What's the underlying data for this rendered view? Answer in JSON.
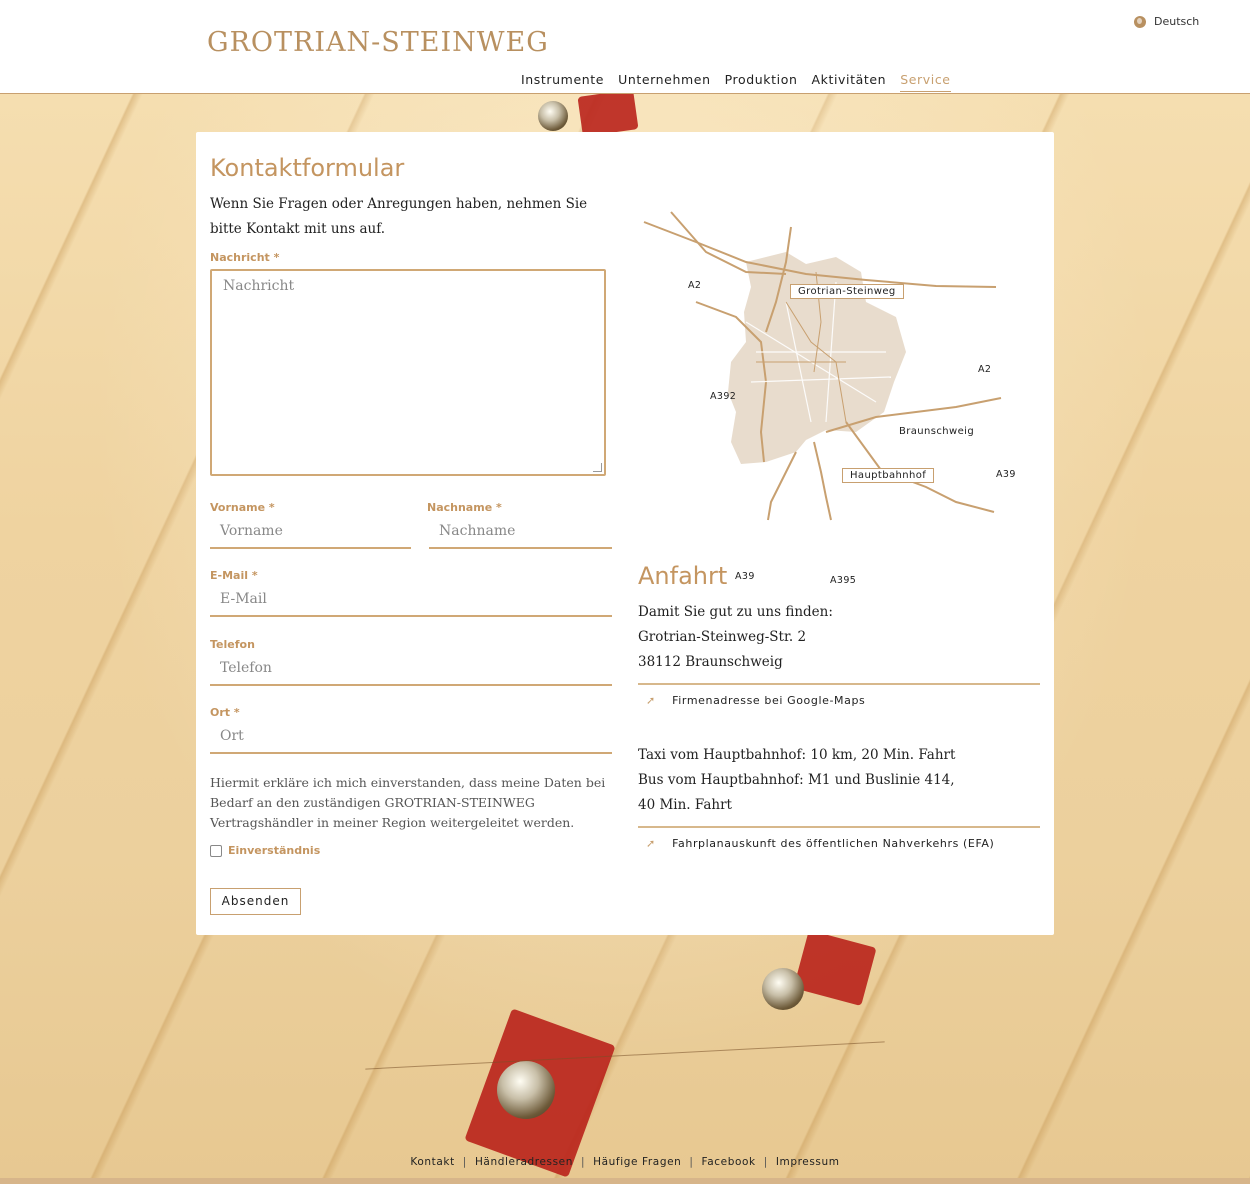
{
  "header": {
    "logo": "GROTRIAN-STEINWEG",
    "language": "Deutsch",
    "nav": [
      "Instrumente",
      "Unternehmen",
      "Produktion",
      "Aktivitäten",
      "Service"
    ],
    "active_nav": "Service"
  },
  "form": {
    "title": "Kontaktformular",
    "intro": "Wenn Sie Fragen oder Anregungen haben, nehmen Sie bitte Kontakt mit uns auf.",
    "message_label": "Nachricht *",
    "message_placeholder": "Nachricht",
    "firstname_label": "Vorname *",
    "firstname_placeholder": "Vorname",
    "lastname_label": "Nachname *",
    "lastname_placeholder": "Nachname",
    "email_label": "E-Mail *",
    "email_placeholder": "E-Mail",
    "phone_label": "Telefon",
    "phone_placeholder": "Telefon",
    "city_label": "Ort *",
    "city_placeholder": "Ort",
    "consent_text": "Hiermit erkläre ich mich einverstanden, dass meine Daten bei Bedarf an den zuständigen GROTRIAN-STEINWEG Vertragshändler in meiner Region weitergeleitet werden.",
    "consent_label": "Einverständnis",
    "submit_label": "Absenden"
  },
  "map": {
    "tag_company": "Grotrian-Steinweg",
    "tag_station": "Hauptbahnhof",
    "city": "Braunschweig",
    "roads": [
      "A2",
      "A2",
      "A392",
      "A39",
      "A39",
      "A395"
    ]
  },
  "directions": {
    "title": "Anfahrt",
    "line1": "Damit Sie gut zu uns finden:",
    "line2": "Grotrian-Steinweg-Str. 2",
    "line3": "38112 Braunschweig",
    "maps_link": "Firmenadresse bei Google-Maps",
    "taxi1": "Taxi vom Hauptbahnhof: 10 km, 20 Min. Fahrt",
    "taxi2": "Bus vom Hauptbahnhof: M1 und Buslinie 414,",
    "taxi3": "40 Min. Fahrt",
    "efa_link": "Fahrplanauskunft des öffentlichen Nahverkehrs (EFA)"
  },
  "footer": {
    "links": [
      "Kontakt",
      "Händleradressen",
      "Häufige Fragen",
      "Facebook",
      "Impressum"
    ]
  },
  "colors": {
    "accent": "#c49560",
    "line": "#d0a875"
  }
}
